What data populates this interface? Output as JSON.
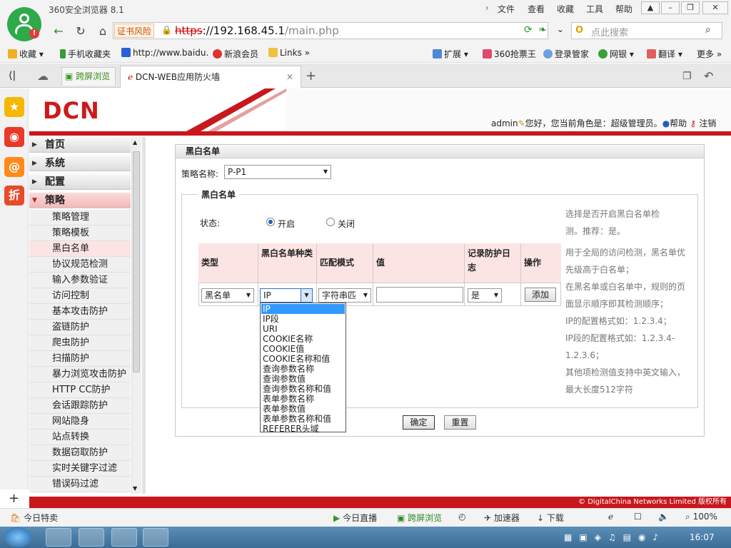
{
  "browser": {
    "title": "360安全浏览器 8.1",
    "menus": [
      "文件",
      "查看",
      "收藏",
      "工具",
      "帮助"
    ],
    "cert_warning": "证书风险",
    "url_scheme": "https",
    "url_rest": "://192.168.45.1",
    "url_path": "/main.php",
    "search_placeholder": "点此搜索",
    "bookmarks": [
      "收藏",
      "手机收藏夹",
      "http://www.baidu.",
      "新浪会员",
      "Links"
    ],
    "bookmarks_right": [
      "扩展",
      "360抢票王",
      "登录管家",
      "网银",
      "翻译",
      "更多"
    ],
    "tab_split_label": "跨屏浏览",
    "tab_active_label": "DCN-WEB应用防火墙"
  },
  "page_header": {
    "brand": "DCN",
    "username": "admin",
    "greeting": "您好，您当前角色是：超级管理员。",
    "help": "帮助",
    "logout": "注销"
  },
  "nav": {
    "top": [
      "首页",
      "系统",
      "配置",
      "策略"
    ],
    "sub": [
      "策略管理",
      "策略模板",
      "黑白名单",
      "协议规范检测",
      "输入参数验证",
      "访问控制",
      "基本攻击防护",
      "盗链防护",
      "爬虫防护",
      "扫描防护",
      "暴力浏览攻击防护",
      "HTTP CC防护",
      "会话跟踪防护",
      "网站隐身",
      "站点转换",
      "数据窃取防护",
      "实时关键字过滤",
      "错误码过滤"
    ],
    "selected_sub": "黑白名单"
  },
  "panel": {
    "title": "黑白名单",
    "policy_label": "策略名称:",
    "policy_value": "P-P1",
    "legend": "黑白名单",
    "status_label": "状态:",
    "radio_on": "开启",
    "radio_off": "关闭",
    "columns": [
      "类型",
      "黑白名单种类",
      "匹配模式",
      "值",
      "记录防护日志",
      "操作"
    ],
    "row": {
      "type": "黑名单",
      "kind": "IP",
      "match": "字符串匹",
      "value": "",
      "log": "是",
      "action": "添加"
    },
    "dropdown_options": [
      "IP",
      "IP段",
      "URI",
      "COOKIE名称",
      "COOKIE值",
      "COOKIE名称和值",
      "查询参数名称",
      "查询参数值",
      "查询参数名称和值",
      "表单参数名称",
      "表单参数值",
      "表单参数名称和值",
      "REFERER头域"
    ],
    "help_lines": [
      "选择是否开启黑白名单检",
      "测。推荐：是。",
      "用于全局的访问检测，黑名单优",
      "先级高于白名单；",
      "在黑名单或白名单中，规则的页",
      "面显示顺序即其检测顺序；",
      "IP的配置格式如：1.2.3.4；",
      "IP段的配置格式如：1.2.3.4-",
      "1.2.3.6；",
      "其他项检测值支持中英文输入，",
      "最大长度512字符"
    ],
    "confirm": "确定",
    "reset": "重置"
  },
  "footer": "© DigitalChina Networks Limited 版权所有",
  "statusbar": {
    "left": "今日特卖",
    "items": [
      "今日直播",
      "跨屏浏览",
      "加速器",
      "下载"
    ],
    "zoom": "100%"
  },
  "taskbar": {
    "clock": "16:07"
  },
  "colors": {
    "brand_red": "#c8171d",
    "header_pink": "#fde4e4",
    "highlight": "#3399ff",
    "green": "#2eaa4a"
  }
}
